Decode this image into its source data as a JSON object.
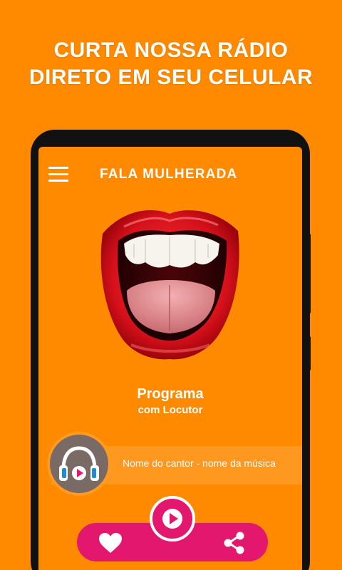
{
  "promo": {
    "line1": "CURTA NOSSA RÁDIO",
    "line2": "DIRETO EM SEU CELULAR"
  },
  "app": {
    "title": "FALA MULHERADA"
  },
  "program": {
    "name": "Programa",
    "host": "com Locutor"
  },
  "now_playing": {
    "text": "Nome do cantor - nome da música"
  },
  "icons": {
    "menu": "hamburger-menu-icon",
    "headphones": "headphones-play-icon",
    "play": "play-icon",
    "like": "heart-icon",
    "share": "share-icon"
  },
  "colors": {
    "background": "#ff8a00",
    "accent": "#e3176e",
    "text": "#ffffff"
  }
}
